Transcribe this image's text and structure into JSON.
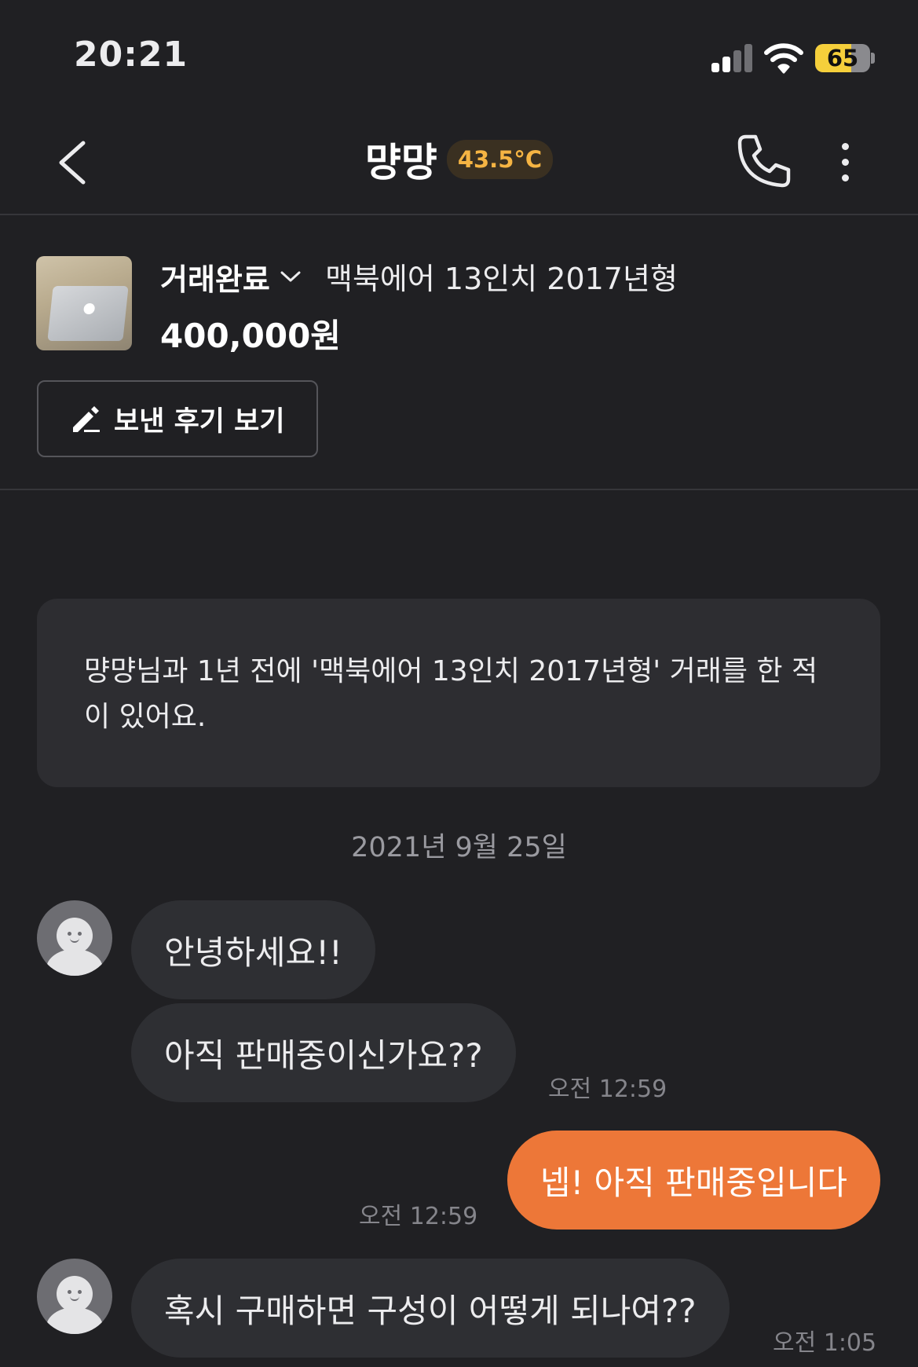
{
  "status_bar": {
    "time": "20:21",
    "battery": "65",
    "battery_level": 0.65
  },
  "header": {
    "name": "먕먕",
    "temperature": "43.5°C",
    "accent_color": "#f5b443"
  },
  "product": {
    "status": "거래완료",
    "title": "맥북에어 13인치 2017년형",
    "price": "400,000원",
    "review_button": "보낸 후기 보기"
  },
  "notice": "먕먕님과 1년 전에 '맥북에어 13인치 2017년형' 거래를 한 적이 있어요.",
  "date_divider": "2021년 9월 25일",
  "messages": [
    {
      "sender": "other",
      "text": "안녕하세요!!",
      "time": ""
    },
    {
      "sender": "other",
      "text": "아직 판매중이신가요??",
      "time": "오전 12:59"
    },
    {
      "sender": "me",
      "text": "넵! 아직 판매중입니다",
      "time": "오전 12:59"
    },
    {
      "sender": "other",
      "text": "혹시 구매하면 구성이 어떻게 되나여??",
      "time": "오전 1:05"
    }
  ],
  "colors": {
    "background": "#202023",
    "my_bubble": "#ed7738",
    "other_bubble": "#2e2f33"
  },
  "icons": [
    "back-chevron-icon",
    "phone-icon",
    "more-vertical-icon",
    "pencil-icon",
    "chevron-down-icon",
    "avatar-icon"
  ]
}
